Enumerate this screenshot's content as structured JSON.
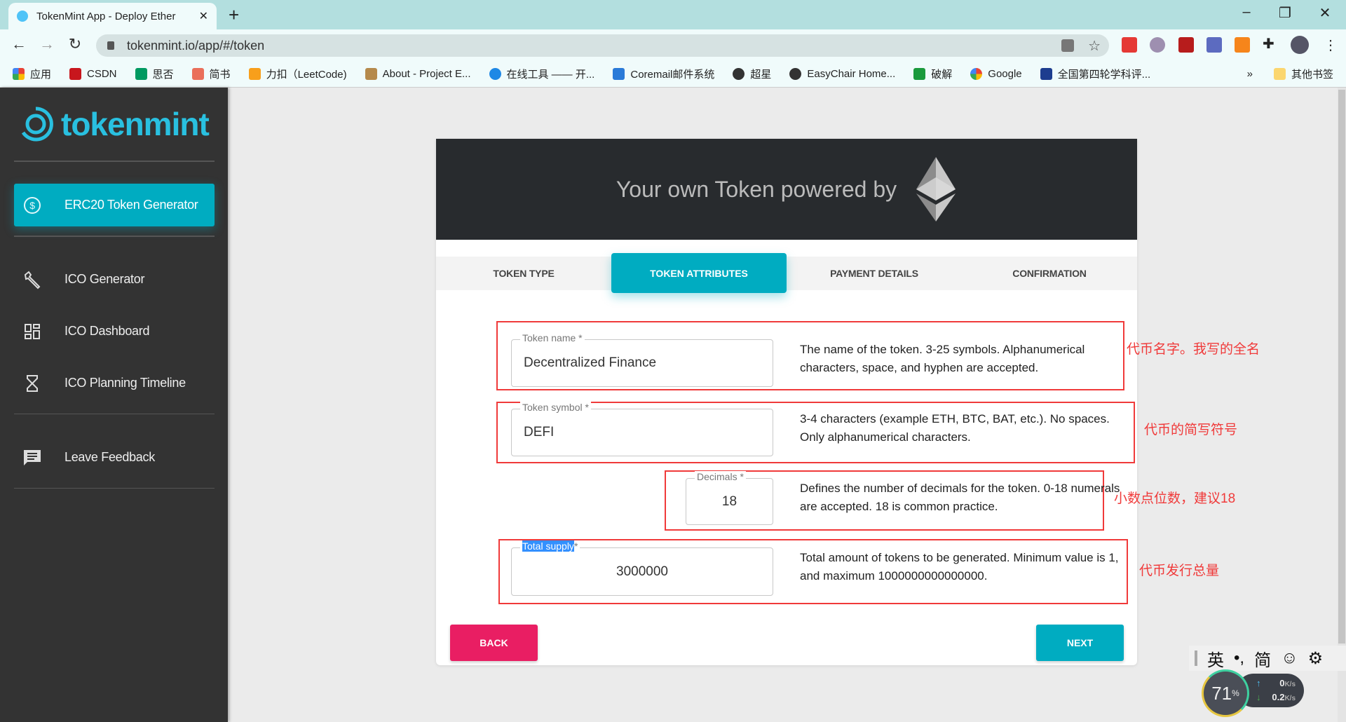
{
  "browser": {
    "tab_title": "TokenMint App - Deploy Ether",
    "new_tab": "+",
    "url": "tokenmint.io/app/#/token",
    "window_controls": {
      "minimize": "–",
      "restore": "❐",
      "close": "✕"
    },
    "bookmarks": [
      {
        "label": "应用",
        "color": "#e94235"
      },
      {
        "label": "CSDN",
        "color": "#c8161d"
      },
      {
        "label": "思否",
        "color": "#009a61"
      },
      {
        "label": "简书",
        "color": "#ea6f5a"
      },
      {
        "label": "力扣（LeetCode)",
        "color": "#f89f1b"
      },
      {
        "label": "About - Project E...",
        "color": "#b58a4c"
      },
      {
        "label": "在线工具 —— 开...",
        "color": "#1e88e5"
      },
      {
        "label": "Coremail邮件系统",
        "color": "#2a7ad8"
      },
      {
        "label": "超星",
        "color": "#333333"
      },
      {
        "label": "EasyChair Home...",
        "color": "#333333"
      },
      {
        "label": "破解",
        "color": "#1a9a3c"
      },
      {
        "label": "Google",
        "color": "#4285f4"
      },
      {
        "label": "全国第四轮学科评...",
        "color": "#1d3d8f"
      }
    ],
    "more_bookmarks": "»",
    "other_bookmarks": "其他书签"
  },
  "sidebar": {
    "logo": "tokenmint",
    "items": [
      {
        "label": "ERC20 Token Generator",
        "icon": "dollar-circle-icon",
        "active": true
      },
      {
        "label": "ICO Generator",
        "icon": "wrench-icon"
      },
      {
        "label": "ICO Dashboard",
        "icon": "dashboard-icon"
      },
      {
        "label": "ICO Planning Timeline",
        "icon": "hourglass-icon"
      },
      {
        "label": "Leave Feedback",
        "icon": "feedback-icon"
      }
    ]
  },
  "hero": {
    "title": "Your own Token powered by",
    "icon": "ethereum-icon"
  },
  "steps": [
    "TOKEN TYPE",
    "TOKEN ATTRIBUTES",
    "PAYMENT DETAILS",
    "CONFIRMATION"
  ],
  "active_step": "TOKEN ATTRIBUTES",
  "form": {
    "token_name": {
      "label": "Token name *",
      "value": "Decentralized Finance",
      "help": "The name of the token. 3-25 symbols. Alphanumerical characters, space, and hyphen are accepted.",
      "note": "代币名字。我写的全名"
    },
    "token_symbol": {
      "label": "Token symbol *",
      "value": "DEFI",
      "help": "3-4 characters (example ETH, BTC, BAT, etc.). No spaces. Only alphanumerical characters.",
      "note": "代币的简写符号"
    },
    "decimals": {
      "label": "Decimals *",
      "value": "18",
      "help": "Defines the number of decimals for the token. 0-18 numerals are accepted. 18 is common practice.",
      "note": "小数点位数，建议18"
    },
    "total_supply": {
      "label": "Total supply",
      "label_star": "*",
      "value": "3000000",
      "help": "Total amount of tokens to be generated. Minimum value is 1, and maximum 1000000000000000.",
      "note": "代币发行总量"
    }
  },
  "buttons": {
    "back": "BACK",
    "next": "NEXT"
  },
  "colors": {
    "accent": "#00acc1",
    "back": "#e91e63",
    "annotation": "#f03a3a",
    "sidebar": "#333333"
  },
  "ime": {
    "lang": "英",
    "punct": "•,",
    "mode": "简"
  },
  "monitor": {
    "percent": "71",
    "percent_unit": "%",
    "up": "0",
    "down": "0.2",
    "unit": "K/s"
  }
}
